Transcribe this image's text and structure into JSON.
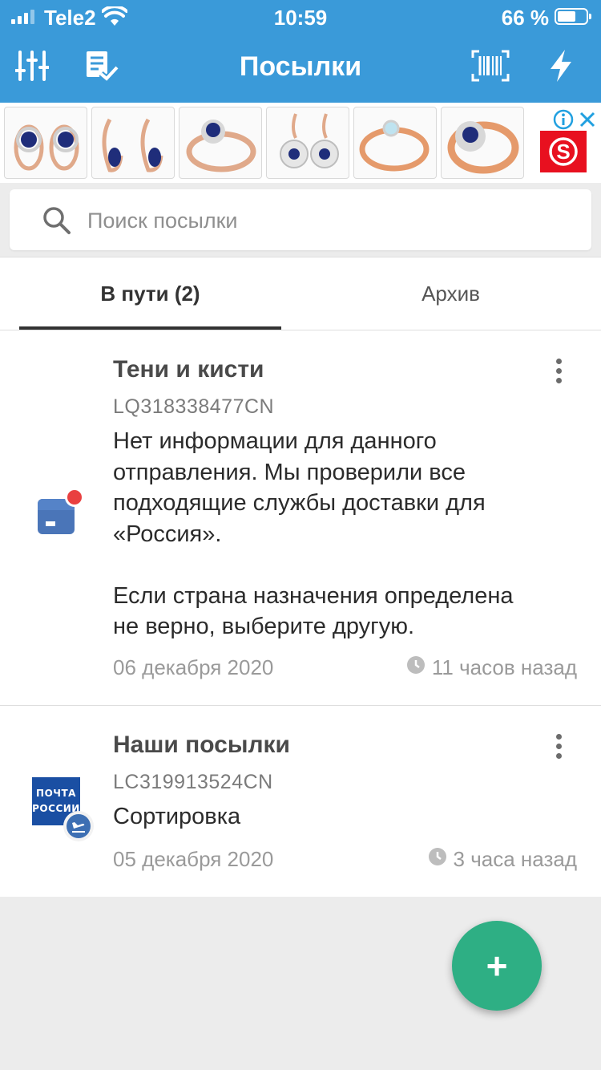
{
  "status_bar": {
    "carrier": "Tele2",
    "time": "10:59",
    "battery_percent": "66 %",
    "battery_level": 0.66
  },
  "app_bar": {
    "title": "Посылки",
    "left_icons": [
      "sliders-icon",
      "checklist-icon"
    ],
    "right_icons": [
      "barcode-scan-icon",
      "lightning-icon"
    ]
  },
  "ad_banner": {
    "items": [
      "ring-product-1",
      "ring-product-2",
      "ring-product-3",
      "ring-product-4",
      "ring-product-5",
      "ring-product-6"
    ],
    "brand_letter": "S",
    "brand_color": "#e8101f"
  },
  "search": {
    "placeholder": "Поиск посылки"
  },
  "tabs": [
    {
      "label": "В пути (2)",
      "active": true
    },
    {
      "label": "Архив",
      "active": false
    }
  ],
  "parcels": [
    {
      "name": "Тени и кисти",
      "tracking": "LQ318338477CN",
      "status_lines": [
        "Нет информации для данного",
        "отправления. Мы проверили все",
        "подходящие службы доставки для",
        "«Россия».",
        "",
        "Если страна назначения определена",
        "не верно, выберите другую."
      ],
      "date": "06 декабря 2020",
      "ago": "11 часов назад",
      "icon": "parcel-box-icon"
    },
    {
      "name": "Наши посылки",
      "tracking": "LC319913524CN",
      "status_lines": [
        "Сортировка"
      ],
      "date": "05 декабря 2020",
      "ago": "3 часа назад",
      "icon": "russian-post-logo",
      "logo_text": [
        "ПОЧТА",
        "РОССИИ"
      ]
    }
  ],
  "fab": {
    "label": "+"
  },
  "colors": {
    "primary": "#3a9ad9",
    "fab": "#2eaf84",
    "badge": "#e94040"
  }
}
